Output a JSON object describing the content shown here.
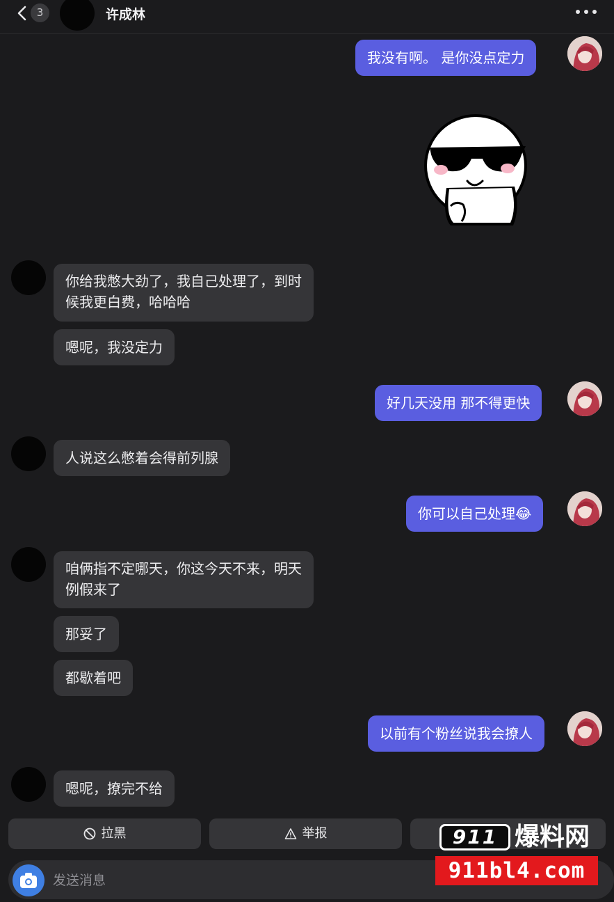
{
  "header": {
    "unread_count": "3",
    "contact_name": "许成林"
  },
  "messages": [
    {
      "side": "out",
      "text": "我没有啊。  是你没点定力"
    },
    {
      "side": "out",
      "type": "sticker",
      "icon": "cool-sunglasses-face-sticker"
    },
    {
      "side": "in",
      "lines": [
        "你给我憋大劲了，我自己处理了，到时",
        "候我更白费，哈哈哈"
      ]
    },
    {
      "side": "in",
      "text": "嗯呢，我没定力"
    },
    {
      "side": "out",
      "text": "好几天没用  那不得更快"
    },
    {
      "side": "in",
      "text": "人说这么憋着会得前列腺"
    },
    {
      "side": "out",
      "text": "你可以自己处理",
      "emoji": "😂"
    },
    {
      "side": "in",
      "lines": [
        "咱俩指不定哪天，你这今天不来，明天",
        "例假来了"
      ]
    },
    {
      "side": "in",
      "text": "那妥了"
    },
    {
      "side": "in",
      "text": "都歇着吧"
    },
    {
      "side": "out",
      "text": "以前有个粉丝说我会撩人"
    },
    {
      "side": "in",
      "text": "嗯呢，撩完不给"
    }
  ],
  "actions": {
    "block_label": "拉黑",
    "report_label": "举报"
  },
  "input": {
    "placeholder": "发送消息"
  },
  "watermark": {
    "number": "911",
    "name": "爆料网",
    "url": "911bl4.com"
  },
  "colors": {
    "background": "#1b1b1d",
    "outgoing_bubble": "#5a5ee0",
    "incoming_bubble": "#353538",
    "camera_button": "#3f7fe3",
    "watermark_red": "#e3191d"
  }
}
